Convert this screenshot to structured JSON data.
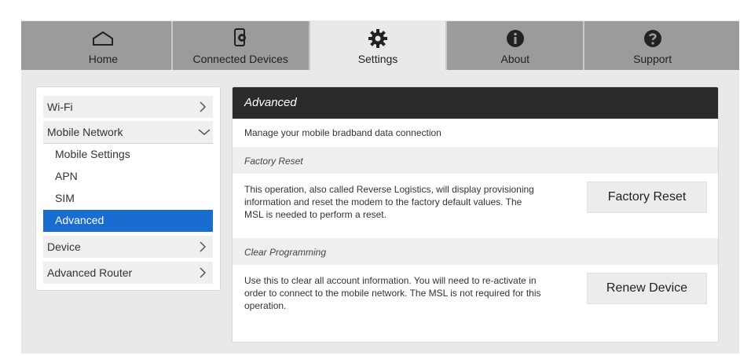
{
  "nav": {
    "tabs": [
      {
        "label": "Home",
        "icon": "home-icon"
      },
      {
        "label": "Connected Devices",
        "icon": "connected-devices-icon"
      },
      {
        "label": "Settings",
        "icon": "gear-icon"
      },
      {
        "label": "About",
        "icon": "info-icon"
      },
      {
        "label": "Support",
        "icon": "help-icon"
      }
    ],
    "active_tab": "Settings"
  },
  "sidebar": {
    "items": [
      {
        "label": "Wi-Fi"
      },
      {
        "label": "Mobile Network"
      },
      {
        "label": "Device"
      },
      {
        "label": "Advanced Router"
      }
    ],
    "sub_items": [
      {
        "label": "Mobile Settings"
      },
      {
        "label": "APN"
      },
      {
        "label": "SIM"
      },
      {
        "label": "Advanced"
      }
    ],
    "active_sub_item": "Advanced"
  },
  "main": {
    "title": "Advanced",
    "description": "Manage your mobile bradband data connection",
    "sections": [
      {
        "heading": "Factory Reset",
        "text": "This operation, also called Reverse Logistics, will display provisioning information and reset the modem to the factory default values. The MSL is needed to perform a reset.",
        "button": "Factory Reset"
      },
      {
        "heading": "Clear Programming",
        "text": "Use this to clear all account information. You will need to re-activate in order to connect to the mobile network. The MSL is not required for this operation.",
        "button": "Renew Device"
      }
    ]
  },
  "colors": {
    "nav_bg": "#9b9b9b",
    "active_bg": "#e9e9e9",
    "header_bg": "#2b2b2b",
    "selection": "#1a6dd0"
  }
}
